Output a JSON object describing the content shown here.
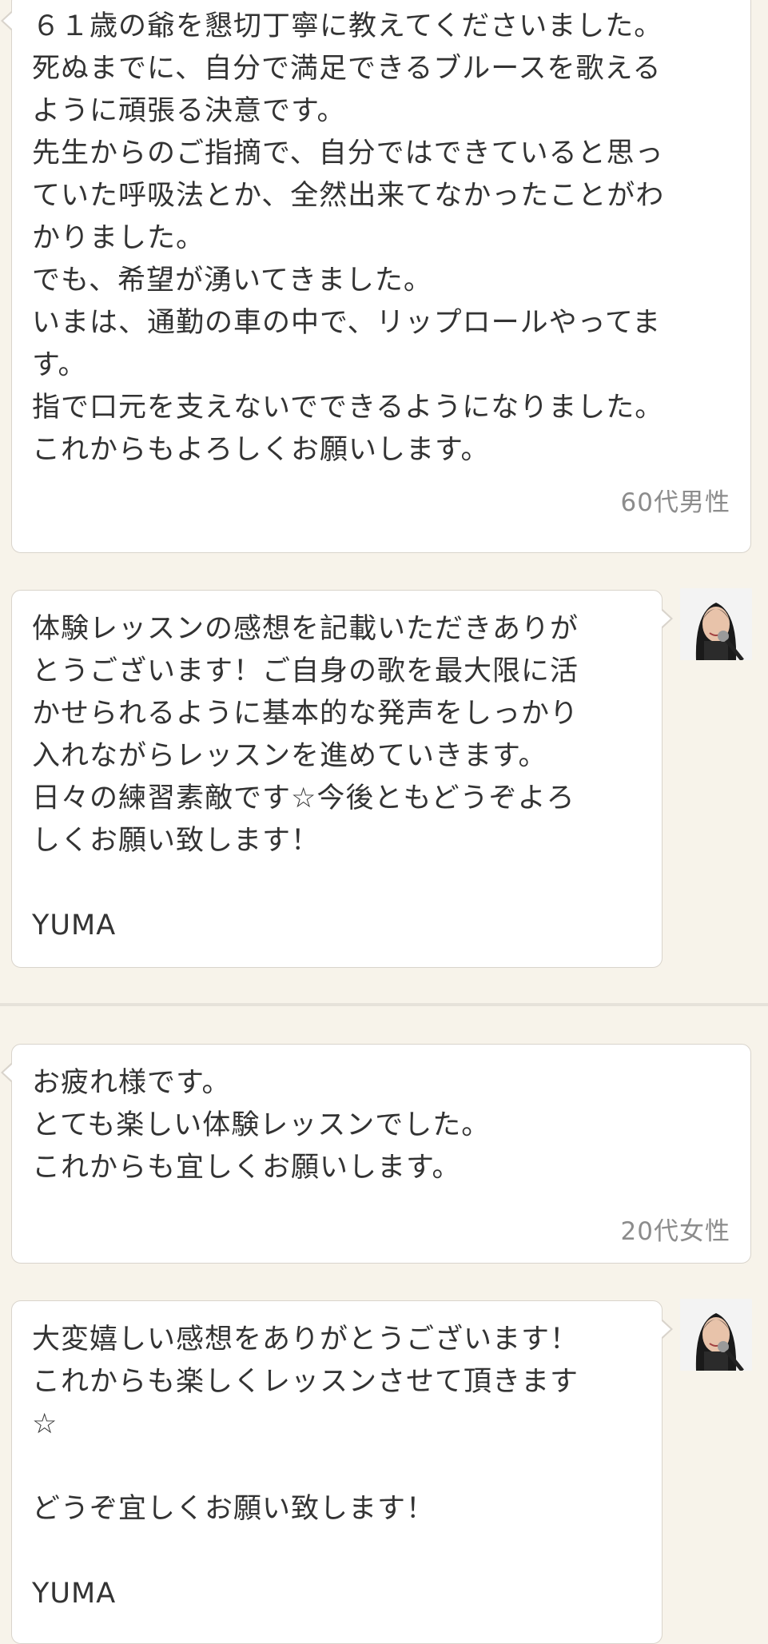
{
  "conversation": [
    {
      "type": "review",
      "text": "６１歳の爺を懇切丁寧に教えてくださいました。\n死ぬまでに、自分で満足できるブルースを歌える\nように頑張る決意です。\n先生からのご指摘で、自分ではできていると思っ\nていた呼吸法とか、全然出来てなかったことがわ\nかりました。\nでも、希望が湧いてきました。\nいまは、通勤の車の中で、リップロールやってま\nす。\n指で口元を支えないでできるようになりました。\nこれからもよろしくお願いします。",
      "author": "60代男性"
    },
    {
      "type": "reply",
      "text": "体験レッスンの感想を記載いただきありが\nとうございます！ご自身の歌を最大限に活\nかせられるように基本的な発声をしっかり\n入れながらレッスンを進めていきます。\n日々の練習素敵です☆今後ともどうぞよろ\nしくお願い致します！\n\nYUMA",
      "avatar_icon": "teacher-avatar-icon"
    },
    {
      "type": "review",
      "text": "お疲れ様です。\nとても楽しい体験レッスンでした。\nこれからも宜しくお願いします。",
      "author": "20代女性"
    },
    {
      "type": "reply",
      "text": "大変嬉しい感想をありがとうございます！\nこれからも楽しくレッスンさせて頂きます\n☆\n\nどうぞ宜しくお願い致します！\n\nYUMA",
      "avatar_icon": "teacher-avatar-icon"
    }
  ],
  "colors": {
    "background": "#f7f3ea",
    "bubble": "#ffffff",
    "border": "#d9d4cc",
    "text": "#333333",
    "author": "#8c8c8c"
  }
}
